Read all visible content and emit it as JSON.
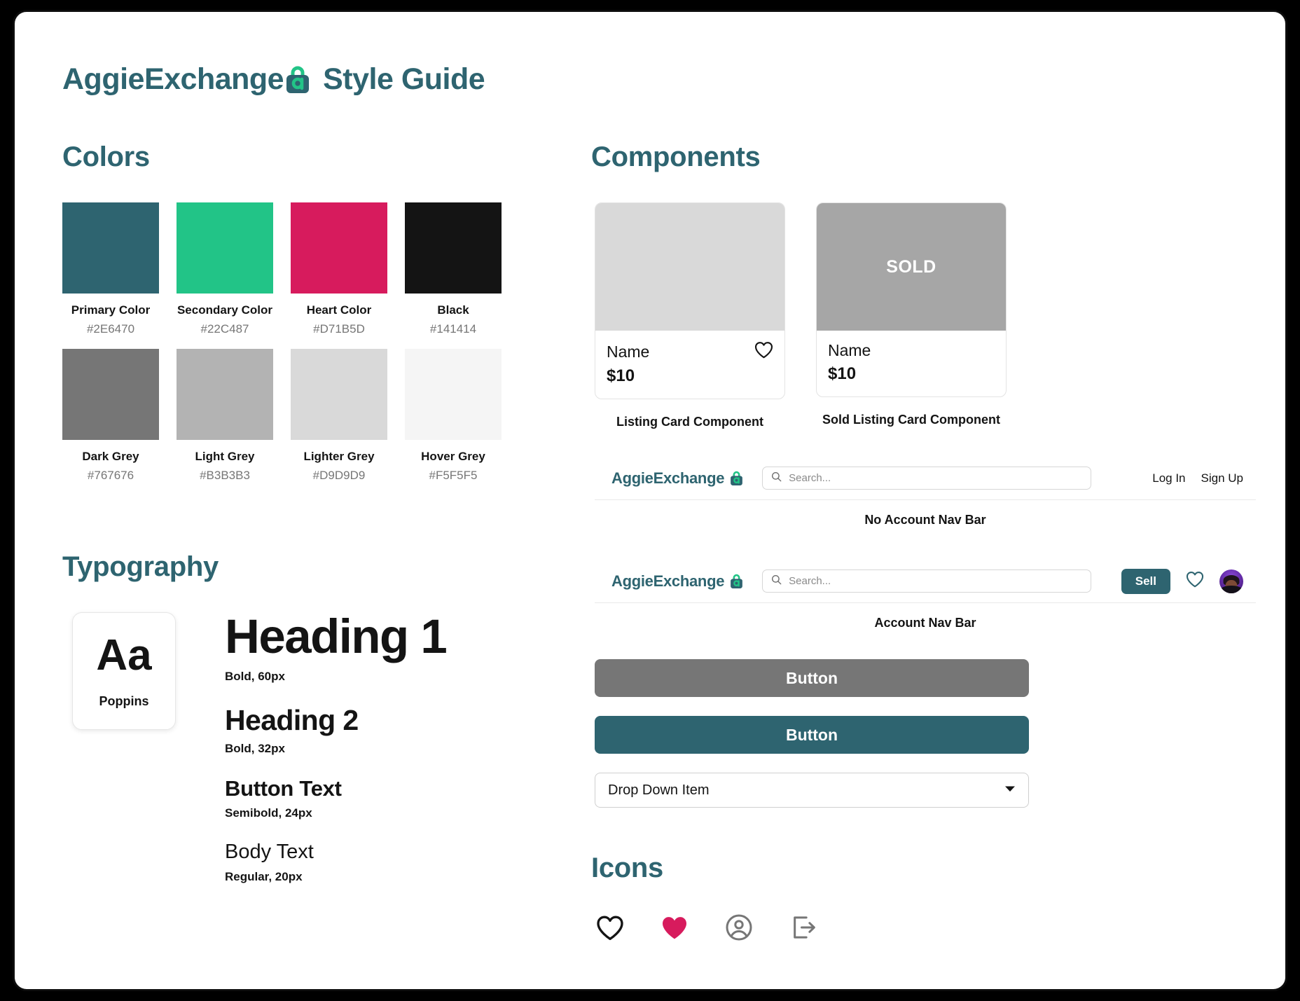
{
  "page": {
    "title_brand": "AggieExchange",
    "title_suffix": "Style Guide"
  },
  "sections": {
    "colors": "Colors",
    "typography": "Typography",
    "components": "Components",
    "icons": "Icons"
  },
  "colors": [
    {
      "name": "Primary Color",
      "hex": "#2E6470"
    },
    {
      "name": "Secondary Color",
      "hex": "#22C487"
    },
    {
      "name": "Heart Color",
      "hex": "#D71B5D"
    },
    {
      "name": "Black",
      "hex": "#141414"
    },
    {
      "name": "Dark Grey",
      "hex": "#767676"
    },
    {
      "name": "Light Grey",
      "hex": "#B3B3B3"
    },
    {
      "name": "Lighter Grey",
      "hex": "#D9D9D9"
    },
    {
      "name": "Hover Grey",
      "hex": "#F5F5F5"
    }
  ],
  "typography": {
    "font_card": {
      "sample": "Aa",
      "family_name": "Poppins"
    },
    "specimens": [
      {
        "sample": "Heading 1",
        "meta": "Bold, 60px"
      },
      {
        "sample": "Heading 2",
        "meta": "Bold, 32px"
      },
      {
        "sample": "Button Text",
        "meta": "Semibold, 24px"
      },
      {
        "sample": "Body Text",
        "meta": "Regular, 20px"
      }
    ]
  },
  "components": {
    "listing_card": {
      "name": "Name",
      "price": "$10",
      "caption": "Listing Card Component"
    },
    "sold_listing_card": {
      "badge": "SOLD",
      "name": "Name",
      "price": "$10",
      "caption": "Sold Listing Card Component"
    },
    "navbar_no_account": {
      "logo_text": "AggieExchange",
      "search_placeholder": "Search...",
      "log_in": "Log In",
      "sign_up": "Sign Up",
      "caption": "No Account Nav Bar"
    },
    "navbar_account": {
      "logo_text": "AggieExchange",
      "search_placeholder": "Search...",
      "sell": "Sell",
      "caption": "Account Nav Bar"
    },
    "button_grey": "Button",
    "button_primary": "Button",
    "dropdown": "Drop Down Item"
  },
  "icons": [
    {
      "name": "heart-outline-icon",
      "color": "#141414"
    },
    {
      "name": "heart-filled-icon",
      "color": "#D71B5D"
    },
    {
      "name": "account-circle-icon",
      "color": "#767676"
    },
    {
      "name": "logout-icon",
      "color": "#767676"
    }
  ]
}
